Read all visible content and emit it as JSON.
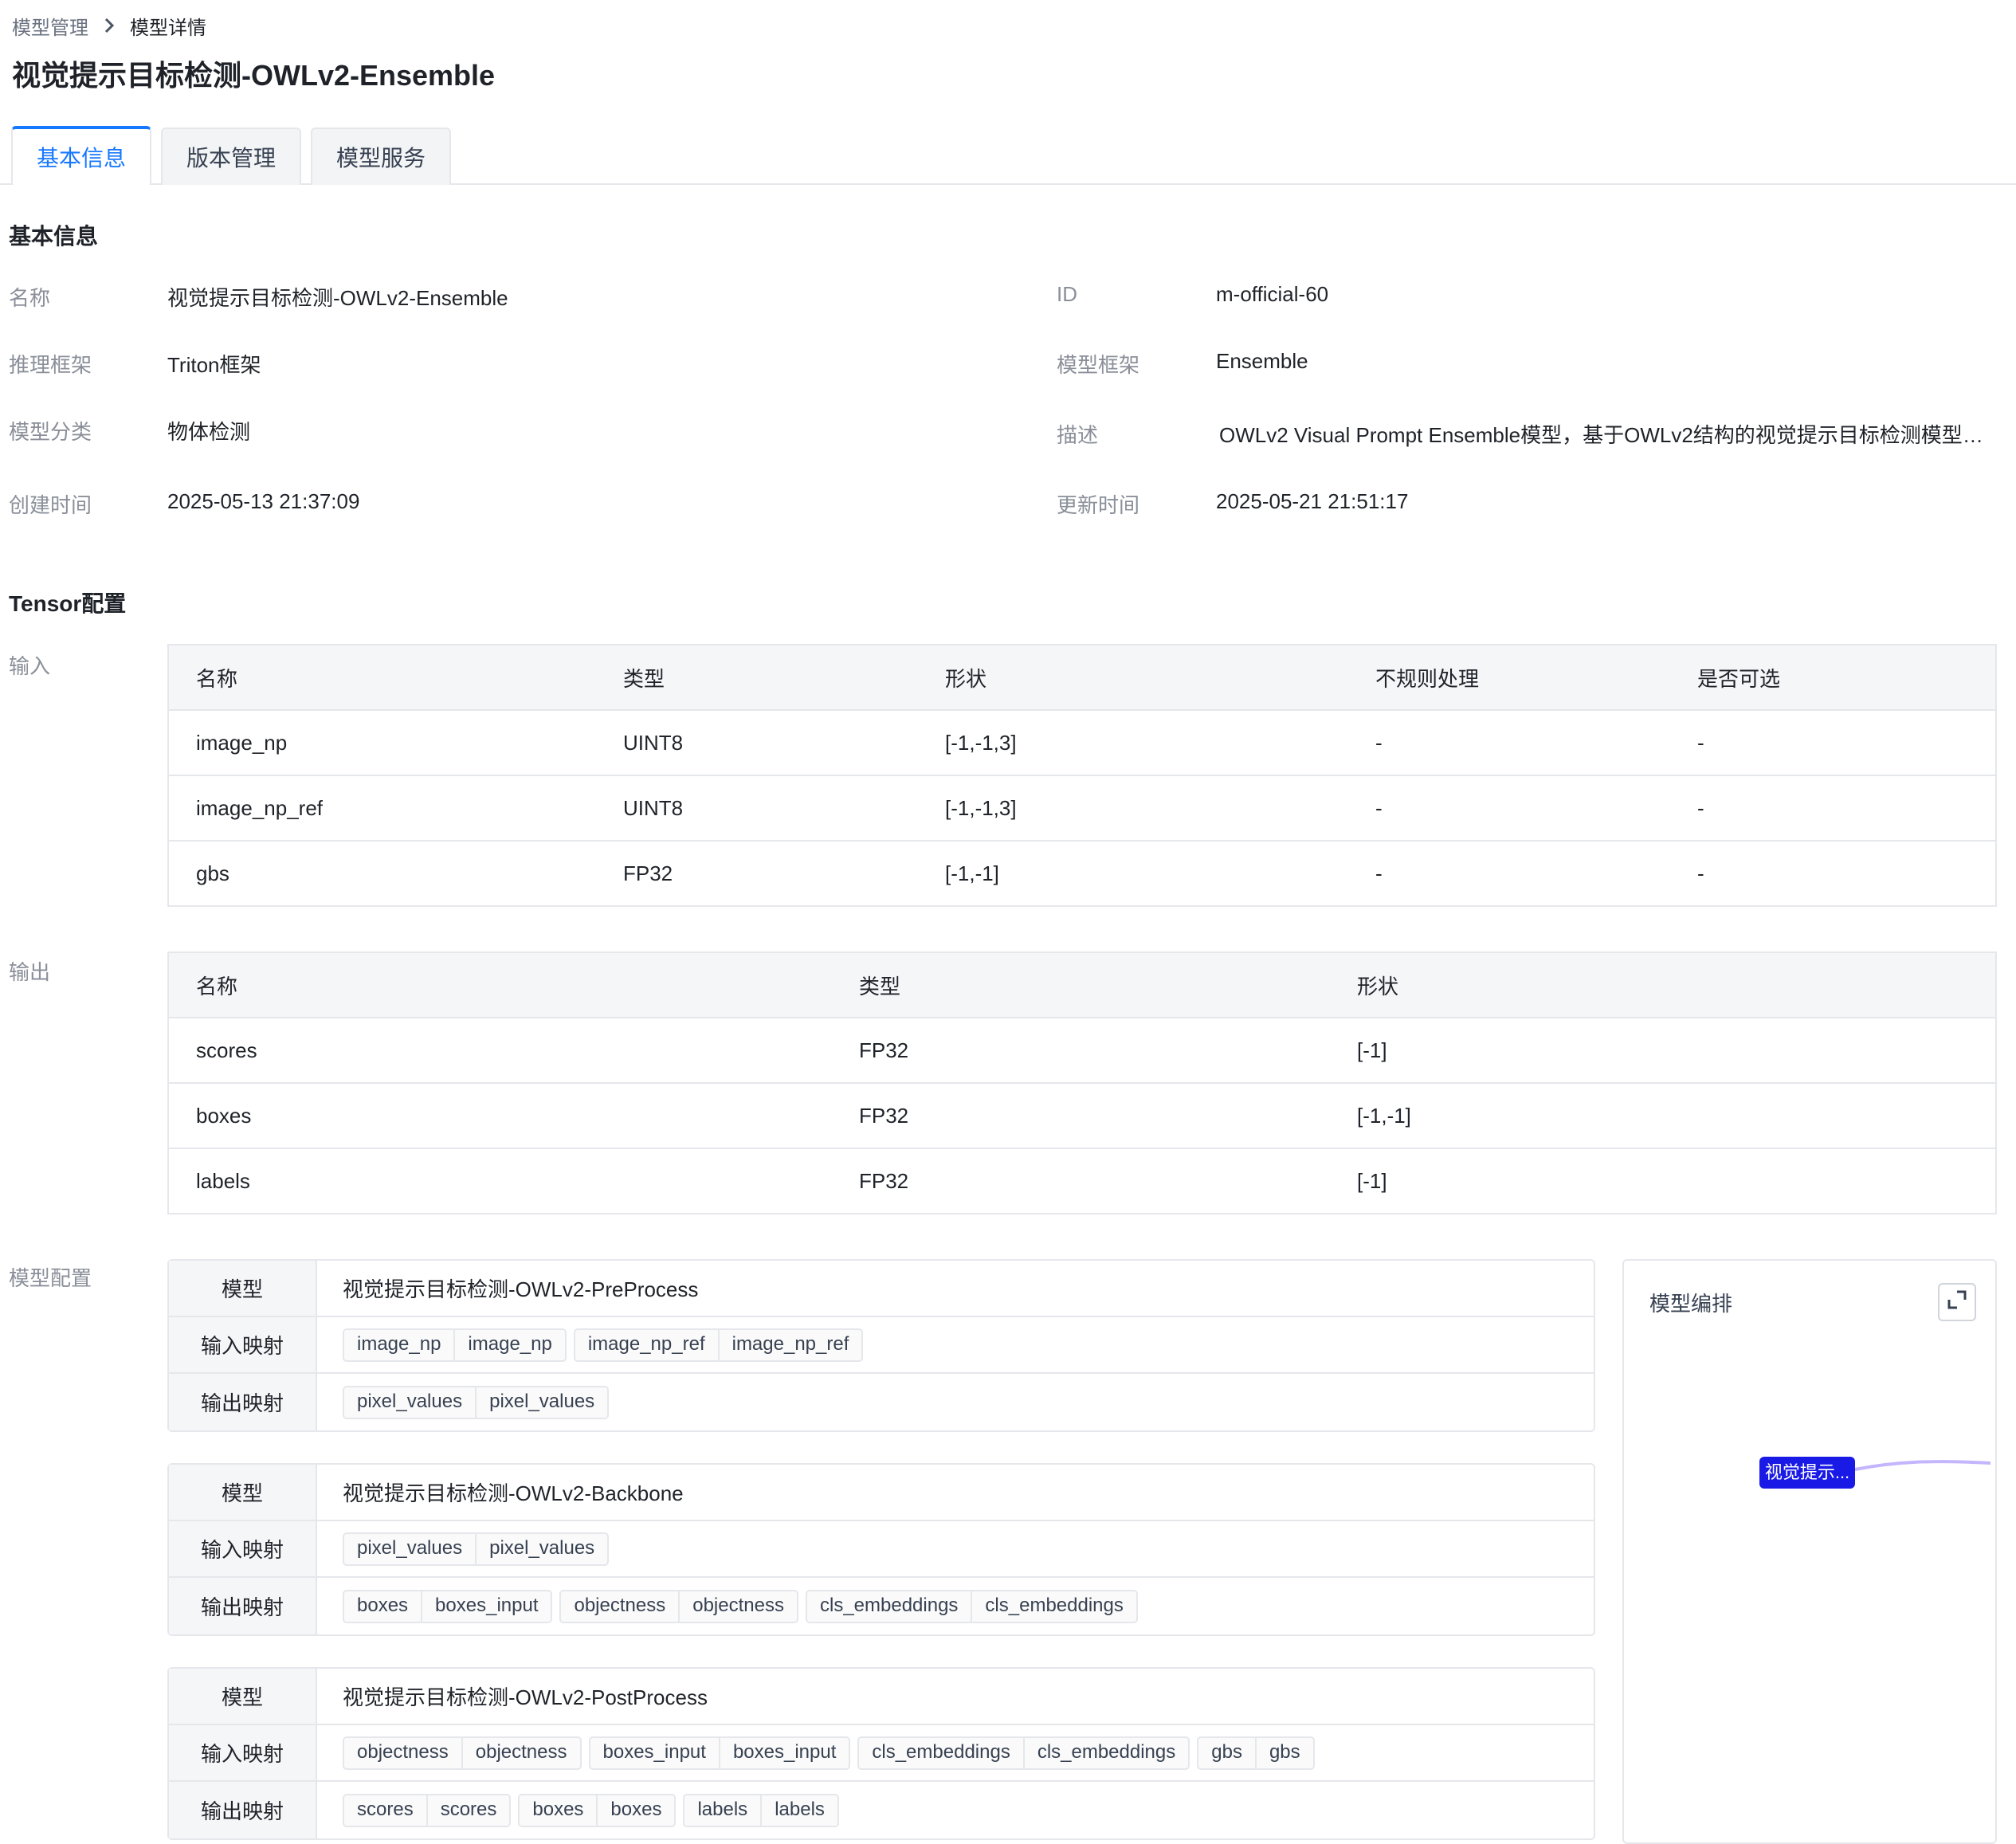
{
  "breadcrumb": {
    "parent": "模型管理",
    "current": "模型详情"
  },
  "page_title": "视觉提示目标检测-OWLv2-Ensemble",
  "tabs": [
    {
      "label": "基本信息",
      "active": true
    },
    {
      "label": "版本管理",
      "active": false
    },
    {
      "label": "模型服务",
      "active": false
    }
  ],
  "basic_info": {
    "section_title": "基本信息",
    "fields": [
      {
        "label": "名称",
        "value": "视觉提示目标检测-OWLv2-Ensemble"
      },
      {
        "label": "ID",
        "value": "m-official-60"
      },
      {
        "label": "推理框架",
        "value": "Triton框架"
      },
      {
        "label": "模型框架",
        "value": "Ensemble"
      },
      {
        "label": "模型分类",
        "value": "物体检测"
      },
      {
        "label": "描述",
        "value": "OWLv2 Visual Prompt Ensemble模型，基于OWLv2结构的视觉提示目标检测模型，..."
      },
      {
        "label": "创建时间",
        "value": "2025-05-13 21:37:09"
      },
      {
        "label": "更新时间",
        "value": "2025-05-21 21:51:17"
      }
    ]
  },
  "tensor": {
    "section_title": "Tensor配置",
    "input_label": "输入",
    "input_columns": [
      "名称",
      "类型",
      "形状",
      "不规则处理",
      "是否可选"
    ],
    "input_rows": [
      [
        "image_np",
        "UINT8",
        "[-1,-1,3]",
        "-",
        "-"
      ],
      [
        "image_np_ref",
        "UINT8",
        "[-1,-1,3]",
        "-",
        "-"
      ],
      [
        "gbs",
        "FP32",
        "[-1,-1]",
        "-",
        "-"
      ]
    ],
    "output_label": "输出",
    "output_columns": [
      "名称",
      "类型",
      "形状"
    ],
    "output_rows": [
      [
        "scores",
        "FP32",
        "[-1]"
      ],
      [
        "boxes",
        "FP32",
        "[-1,-1]"
      ],
      [
        "labels",
        "FP32",
        "[-1]"
      ]
    ]
  },
  "model_config": {
    "label": "模型配置",
    "row_labels": {
      "model": "模型",
      "input_map": "输入映射",
      "output_map": "输出映射"
    },
    "steps": [
      {
        "model": "视觉提示目标检测-OWLv2-PreProcess",
        "input_map": [
          [
            "image_np",
            "image_np"
          ],
          [
            "image_np_ref",
            "image_np_ref"
          ]
        ],
        "output_map": [
          [
            "pixel_values",
            "pixel_values"
          ]
        ]
      },
      {
        "model": "视觉提示目标检测-OWLv2-Backbone",
        "input_map": [
          [
            "pixel_values",
            "pixel_values"
          ]
        ],
        "output_map": [
          [
            "boxes",
            "boxes_input"
          ],
          [
            "objectness",
            "objectness"
          ],
          [
            "cls_embeddings",
            "cls_embeddings"
          ]
        ]
      },
      {
        "model": "视觉提示目标检测-OWLv2-PostProcess",
        "input_map": [
          [
            "objectness",
            "objectness"
          ],
          [
            "boxes_input",
            "boxes_input"
          ],
          [
            "cls_embeddings",
            "cls_embeddings"
          ],
          [
            "gbs",
            "gbs"
          ]
        ],
        "output_map": [
          [
            "scores",
            "scores"
          ],
          [
            "boxes",
            "boxes"
          ],
          [
            "labels",
            "labels"
          ]
        ]
      }
    ]
  },
  "orchestration": {
    "title": "模型编排",
    "node_label": "视觉提示...",
    "node_color": "#1a1ae6",
    "edge_color": "#c4b5fd",
    "expand_icon": "expand-icon"
  },
  "colors": {
    "accent": "#1677ff",
    "label_gray": "#8a8f99",
    "border": "#e5e7eb"
  }
}
